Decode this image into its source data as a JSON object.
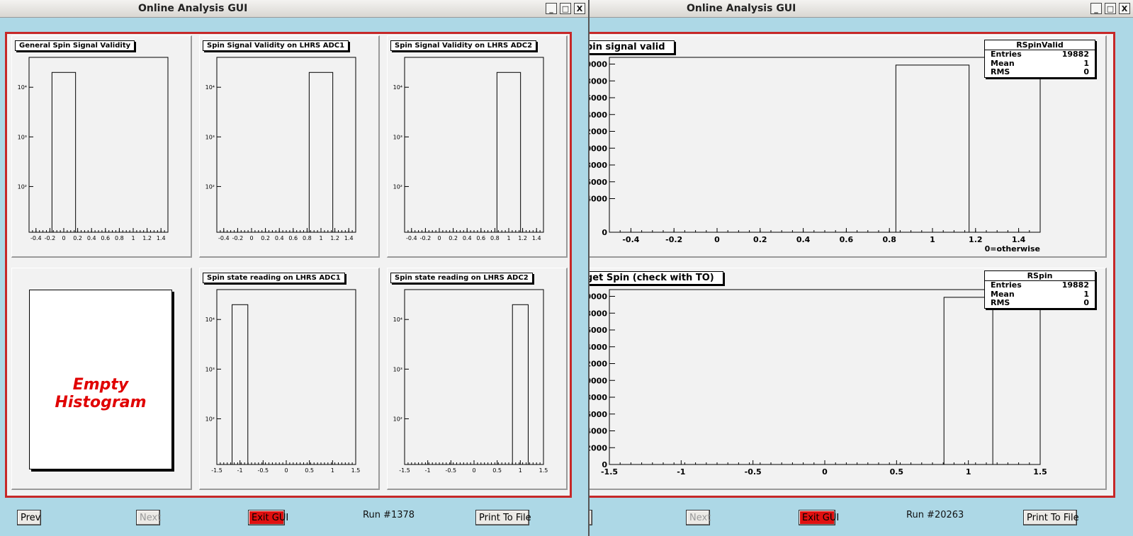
{
  "windows": [
    {
      "title": "Online Analysis GUI",
      "buttons": {
        "prev": "Prev",
        "next": "Next",
        "exit": "Exit GUI",
        "print": "Print To File"
      },
      "run_label": "Run #1378",
      "empty_histogram_text": "Empty Histogram"
    },
    {
      "title": "Online Analysis GUI",
      "buttons": {
        "next": "Next",
        "exit": "Exit GUI",
        "print": "Print To File"
      },
      "run_label": "Run #20263"
    }
  ],
  "window_controls": {
    "minimize": "_",
    "maximize": "□",
    "close": "X"
  },
  "colors": {
    "background": "#add8e6",
    "frame_border": "#c62828",
    "exit_button": "#e01010",
    "empty_text": "#e00000"
  },
  "chart_data": [
    {
      "id": "general_spin",
      "title": "General Spin Signal Validity",
      "type": "bar",
      "yscale": "log",
      "xlim": [
        -0.5,
        1.5
      ],
      "x_ticks": [
        "-0.4",
        "-0.2",
        "0",
        "0.2",
        "0.4",
        "0.6",
        "0.8",
        "1",
        "1.2",
        "1.4"
      ],
      "y_ticks": [
        "10²",
        "10³",
        "10⁴"
      ],
      "bins": [
        {
          "x0": -0.17,
          "x1": 0.17,
          "value": 19882
        }
      ]
    },
    {
      "id": "spin_adc1",
      "title": "Spin Signal Validity on LHRS ADC1",
      "type": "bar",
      "yscale": "log",
      "xlim": [
        -0.5,
        1.5
      ],
      "x_ticks": [
        "-0.4",
        "-0.2",
        "0",
        "0.2",
        "0.4",
        "0.6",
        "0.8",
        "1",
        "1.2",
        "1.4"
      ],
      "y_ticks": [
        "10²",
        "10³",
        "10⁴"
      ],
      "bins": [
        {
          "x0": 0.83,
          "x1": 1.17,
          "value": 19882
        }
      ]
    },
    {
      "id": "spin_adc2",
      "title": "Spin Signal Validity on LHRS ADC2",
      "type": "bar",
      "yscale": "log",
      "xlim": [
        -0.5,
        1.5
      ],
      "x_ticks": [
        "-0.4",
        "-0.2",
        "0",
        "0.2",
        "0.4",
        "0.6",
        "0.8",
        "1",
        "1.2",
        "1.4"
      ],
      "y_ticks": [
        "10²",
        "10³",
        "10⁴"
      ],
      "bins": [
        {
          "x0": 0.83,
          "x1": 1.17,
          "value": 19882
        }
      ]
    },
    {
      "id": "state_adc1",
      "title": "Spin state reading on LHRS ADC1",
      "type": "bar",
      "yscale": "log",
      "xlim": [
        -1.5,
        1.5
      ],
      "x_ticks": [
        "-1.5",
        "-1",
        "-0.5",
        "0",
        "0.5",
        "1",
        "1.5"
      ],
      "y_ticks": [
        "10²",
        "10³",
        "10⁴"
      ],
      "bins": [
        {
          "x0": -1.17,
          "x1": -0.83,
          "value": 19882
        }
      ]
    },
    {
      "id": "state_adc2",
      "title": "Spin state reading on LHRS ADC2",
      "type": "bar",
      "yscale": "log",
      "xlim": [
        -1.5,
        1.5
      ],
      "x_ticks": [
        "-1.5",
        "-1",
        "-0.5",
        "0",
        "0.5",
        "1",
        "1.5"
      ],
      "y_ticks": [
        "10²",
        "10³",
        "10⁴"
      ],
      "bins": [
        {
          "x0": 0.83,
          "x1": 1.17,
          "value": 19882
        }
      ]
    },
    {
      "id": "rspinvalid",
      "title": "pin signal valid",
      "type": "bar",
      "xlim": [
        -0.5,
        1.5
      ],
      "ylim": [
        0,
        20800
      ],
      "x_ticks": [
        "-0.4",
        "-0.2",
        "0",
        "0.2",
        "0.4",
        "0.6",
        "0.8",
        "1",
        "1.2",
        "1.4"
      ],
      "y_ticks": [
        "0",
        "4000",
        "6000",
        "8000",
        "0000",
        "2000",
        "4000",
        "6000",
        "8000",
        "0000"
      ],
      "xlabel": "0=otherwise",
      "bins": [
        {
          "x0": 0.83,
          "x1": 1.17,
          "value": 19882
        }
      ],
      "stats": {
        "name": "RSpinValid",
        "rows": [
          [
            "Entries",
            "19882"
          ],
          [
            "Mean",
            "1"
          ],
          [
            "RMS",
            "0"
          ]
        ]
      }
    },
    {
      "id": "rspin",
      "title": "get Spin (check with TO)",
      "type": "bar",
      "xlim": [
        -1.5,
        1.5
      ],
      "ylim": [
        0,
        20800
      ],
      "x_ticks": [
        "-1.5",
        "-1",
        "-0.5",
        "0",
        "0.5",
        "1",
        "1.5"
      ],
      "y_ticks": [
        "0",
        "2000",
        "4000",
        "6000",
        "8000",
        "0000",
        "2000",
        "4000",
        "6000",
        "8000",
        "0000"
      ],
      "bins": [
        {
          "x0": 0.83,
          "x1": 1.17,
          "value": 19882
        }
      ],
      "stats": {
        "name": "RSpin",
        "rows": [
          [
            "Entries",
            "19882"
          ],
          [
            "Mean",
            "1"
          ],
          [
            "RMS",
            "0"
          ]
        ]
      }
    }
  ]
}
